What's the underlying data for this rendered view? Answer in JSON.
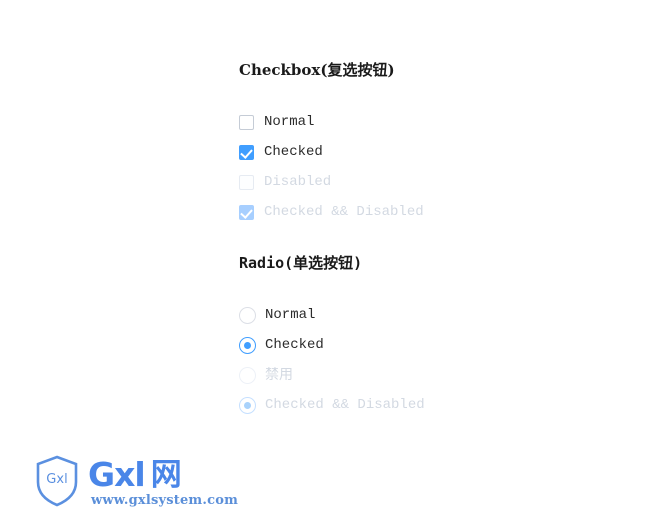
{
  "page": {
    "background_color": "#ffffff",
    "accent_color": "#409eff",
    "accent_disabled_color": "#a7cfff",
    "border_color": "#dcdfe6",
    "disabled_text_color": "#d3d9e2",
    "text_color": "#2b2b2b"
  },
  "checkbox_section": {
    "heading": "Checkbox(复选按钮)",
    "items": [
      {
        "label": "Normal",
        "checked": false,
        "disabled": false
      },
      {
        "label": "Checked",
        "checked": true,
        "disabled": false
      },
      {
        "label": "Disabled",
        "checked": false,
        "disabled": true
      },
      {
        "label": "Checked && Disabled",
        "checked": true,
        "disabled": true
      }
    ]
  },
  "radio_section": {
    "heading": "Radio(单选按钮)",
    "items": [
      {
        "label": "Normal",
        "checked": false,
        "disabled": false
      },
      {
        "label": "Checked",
        "checked": true,
        "disabled": false
      },
      {
        "label": "禁用",
        "checked": false,
        "disabled": true
      },
      {
        "label": "Checked && Disabled",
        "checked": true,
        "disabled": true
      }
    ]
  },
  "watermark": {
    "shield_label": "Gxl",
    "brand": "Gxl",
    "brand_cjk": "网",
    "url": "www.gxlsystem.com",
    "color": "#4a86e8"
  }
}
